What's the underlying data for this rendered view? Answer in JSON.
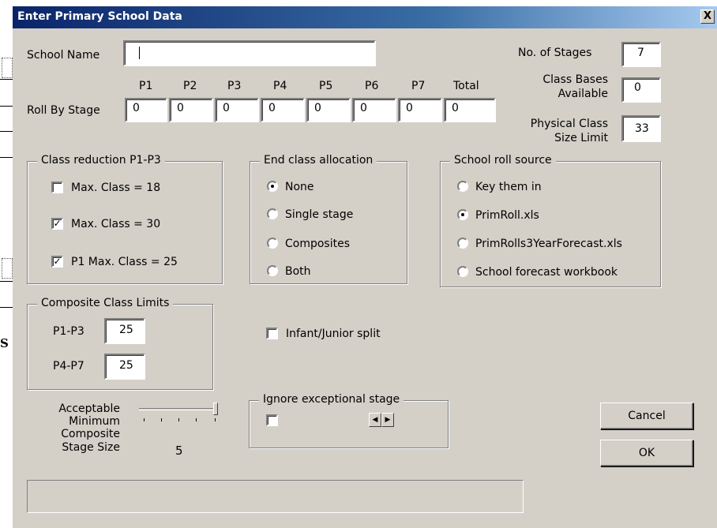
{
  "background": {
    "partial_letter": "S"
  },
  "dialog": {
    "title": "Enter Primary School Data",
    "close_label": "X",
    "school_name_label": "School Name",
    "school_name_value": "",
    "no_of_stages_label": "No. of Stages",
    "no_of_stages_value": "7",
    "class_bases_label_1": "Class Bases",
    "class_bases_label_2": "Available",
    "class_bases_value": "0",
    "physical_limit_label_1": "Physical Class",
    "physical_limit_label_2": "Size Limit",
    "physical_limit_value": "33",
    "roll_by_stage_label": "Roll By Stage",
    "stages": [
      {
        "label": "P1",
        "value": "0"
      },
      {
        "label": "P2",
        "value": "0"
      },
      {
        "label": "P3",
        "value": "0"
      },
      {
        "label": "P4",
        "value": "0"
      },
      {
        "label": "P5",
        "value": "0"
      },
      {
        "label": "P6",
        "value": "0"
      },
      {
        "label": "P7",
        "value": "0"
      },
      {
        "label": "Total",
        "value": "0"
      }
    ],
    "class_reduction": {
      "legend": "Class reduction P1-P3",
      "options": [
        {
          "label": "Max. Class = 18",
          "checked": false
        },
        {
          "label": "Max. Class = 30",
          "checked": true
        },
        {
          "label": "P1 Max. Class = 25",
          "checked": true
        }
      ]
    },
    "end_class": {
      "legend": "End class allocation",
      "options": [
        {
          "label": "None",
          "selected": true
        },
        {
          "label": "Single stage",
          "selected": false
        },
        {
          "label": "Composites",
          "selected": false
        },
        {
          "label": "Both",
          "selected": false
        }
      ]
    },
    "roll_source": {
      "legend": "School roll source",
      "options": [
        {
          "label": "Key them in",
          "selected": false
        },
        {
          "label": "PrimRoll.xls",
          "selected": true
        },
        {
          "label": "PrimRolls3YearForecast.xls",
          "selected": false
        },
        {
          "label": "School forecast workbook",
          "selected": false
        }
      ]
    },
    "composite_limits": {
      "legend": "Composite Class Limits",
      "p1p3_label": "P1-P3",
      "p1p3_value": "25",
      "p4p7_label": "P4-P7",
      "p4p7_value": "25"
    },
    "infant_junior_label": "Infant/Junior split",
    "infant_junior_checked": false,
    "min_composite_label_1": "Acceptable",
    "min_composite_label_2": "Minimum",
    "min_composite_label_3": "Composite",
    "min_composite_label_4": "Stage Size",
    "min_composite_value": "5",
    "min_composite_slider_fraction": 1.0,
    "ignore_stage_legend": "Ignore exceptional stage",
    "ignore_stage_checked": false,
    "spin_left": "◀",
    "spin_right": "▶",
    "cancel_label": "Cancel",
    "ok_label": "OK",
    "status_text": "",
    "colors": {
      "dialog_bg": "#d4d0c8",
      "title_start": "#0a246a",
      "title_end": "#a6caf0"
    }
  }
}
